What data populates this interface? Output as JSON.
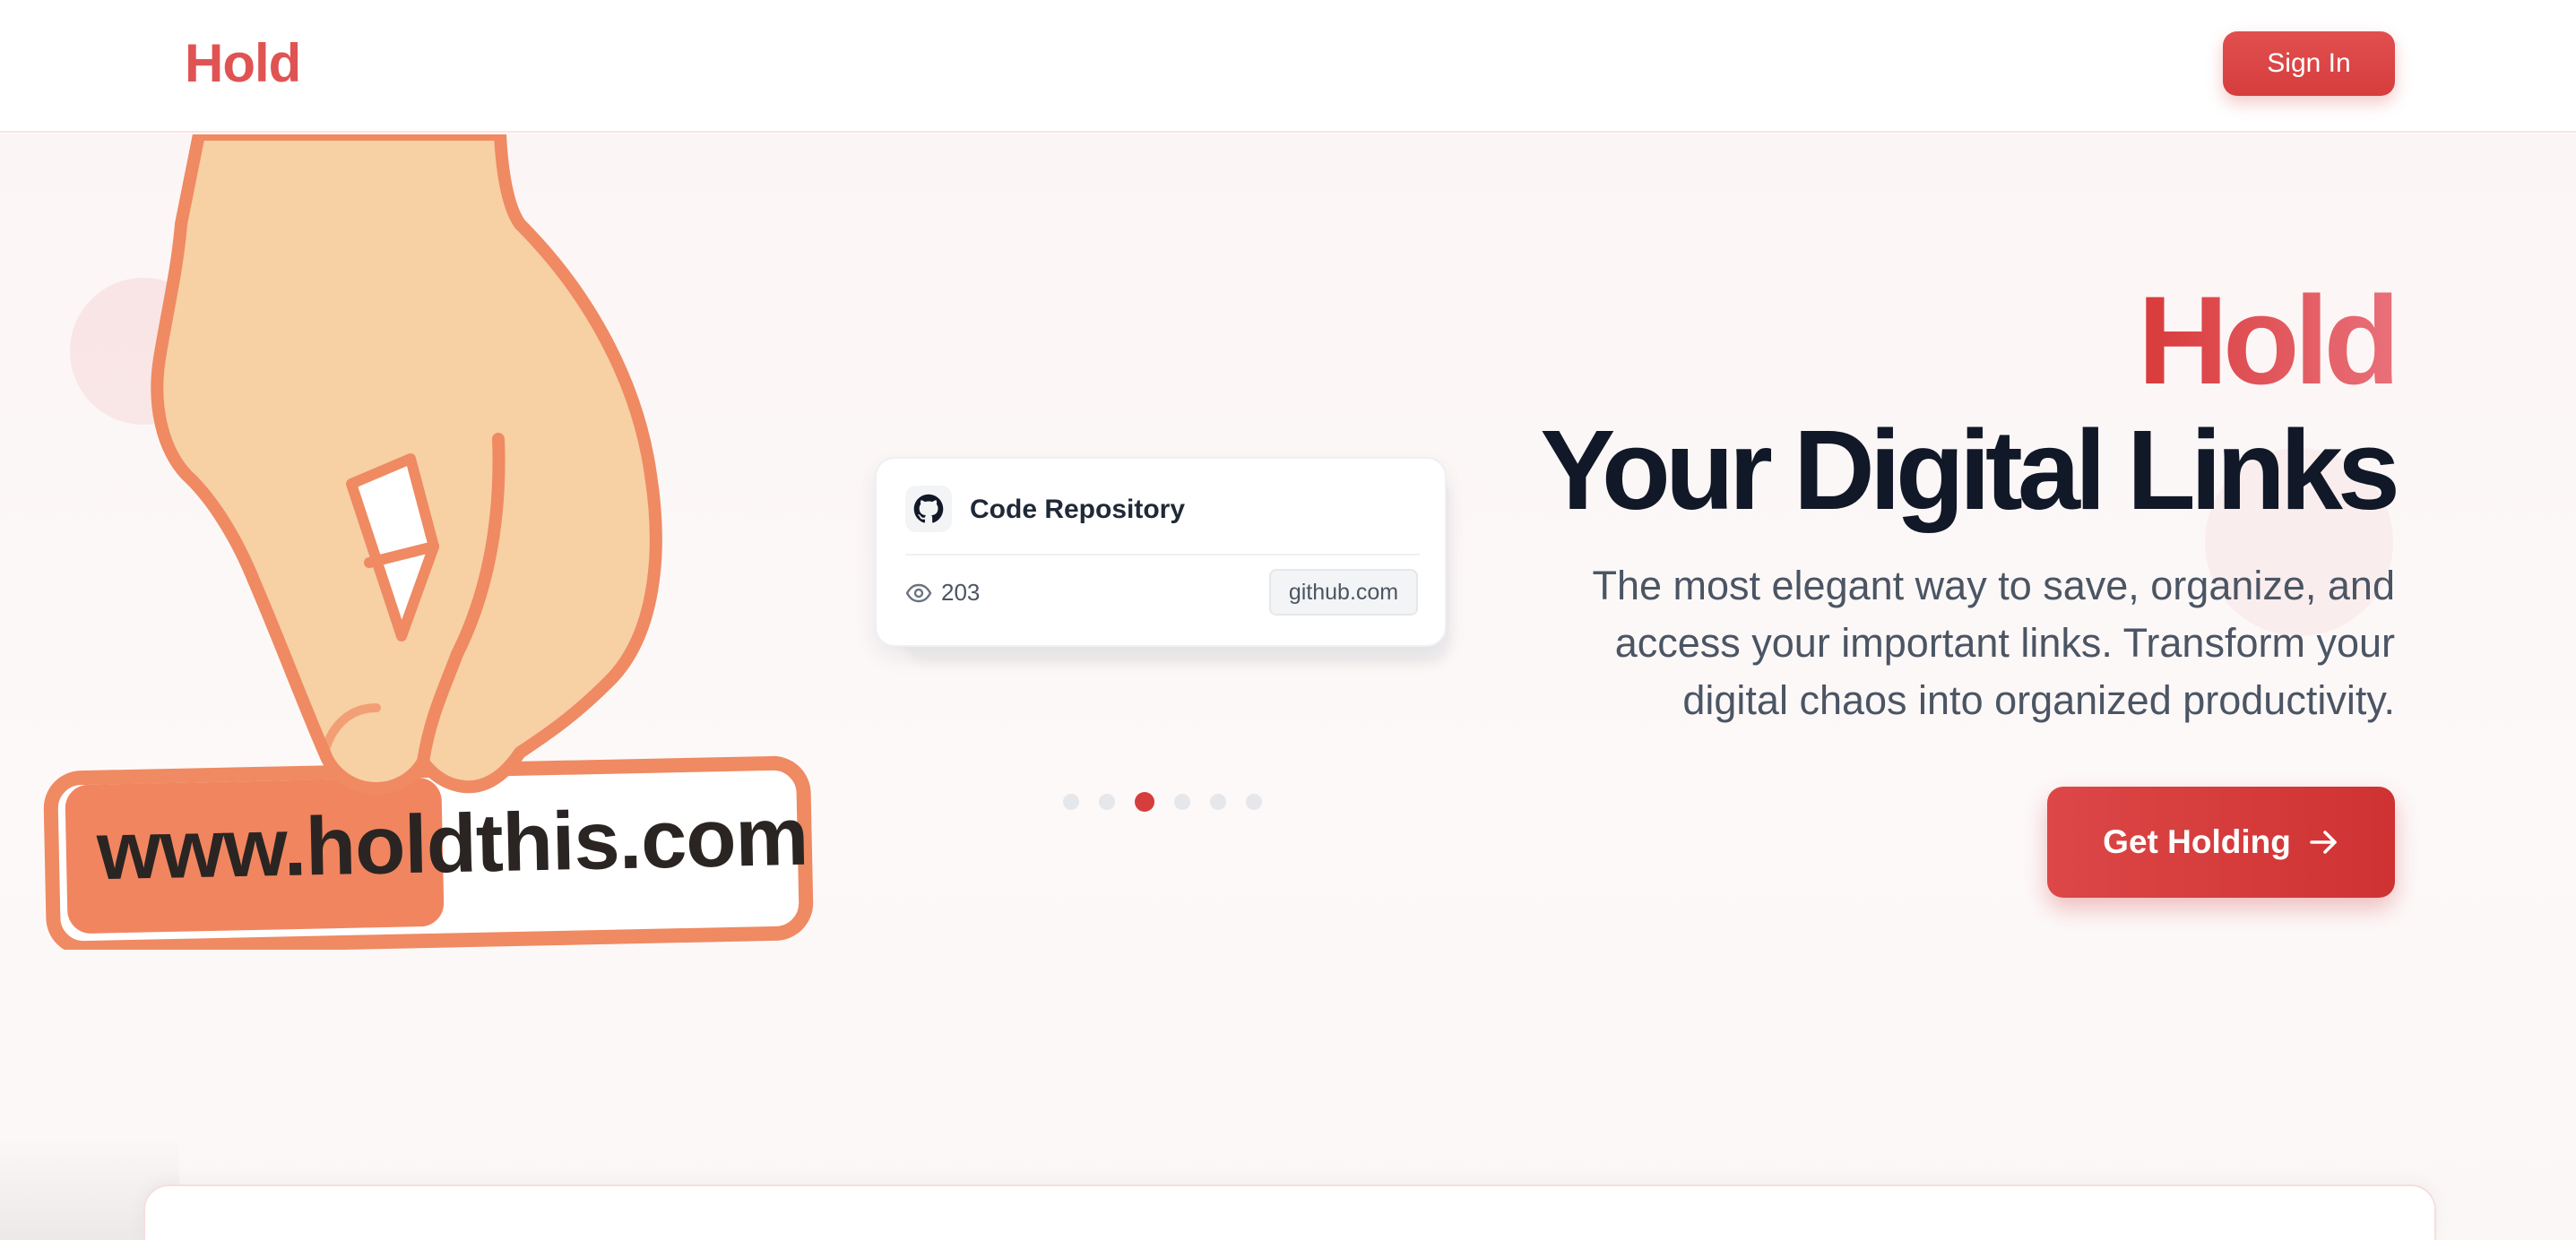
{
  "nav": {
    "brand": "Hold",
    "signin_label": "Sign In"
  },
  "illustration": {
    "stamp_text": "www.holdthis.com",
    "icon": "hand-holding-stamp-icon"
  },
  "link_card": {
    "icon": "github-icon",
    "title": "Code Repository",
    "views_icon": "eye-icon",
    "views": "203",
    "domain": "github.com"
  },
  "carousel": {
    "count": 6,
    "active_index": 2
  },
  "hero": {
    "headline_accent": "Hold",
    "headline_main": "Your Digital Links",
    "subtitle": "The most elegant way to save, organize, and access your important links. Transform your digital chaos into organized productivity.",
    "cta_label": "Get Holding",
    "cta_icon": "arrow-right-icon"
  },
  "colors": {
    "accent": "#d63d3d",
    "brand": "#e05353",
    "skin": "#f6d0a5",
    "stamp_outline": "#ef8a62",
    "heading": "#111827",
    "body_text": "#4b5563"
  }
}
